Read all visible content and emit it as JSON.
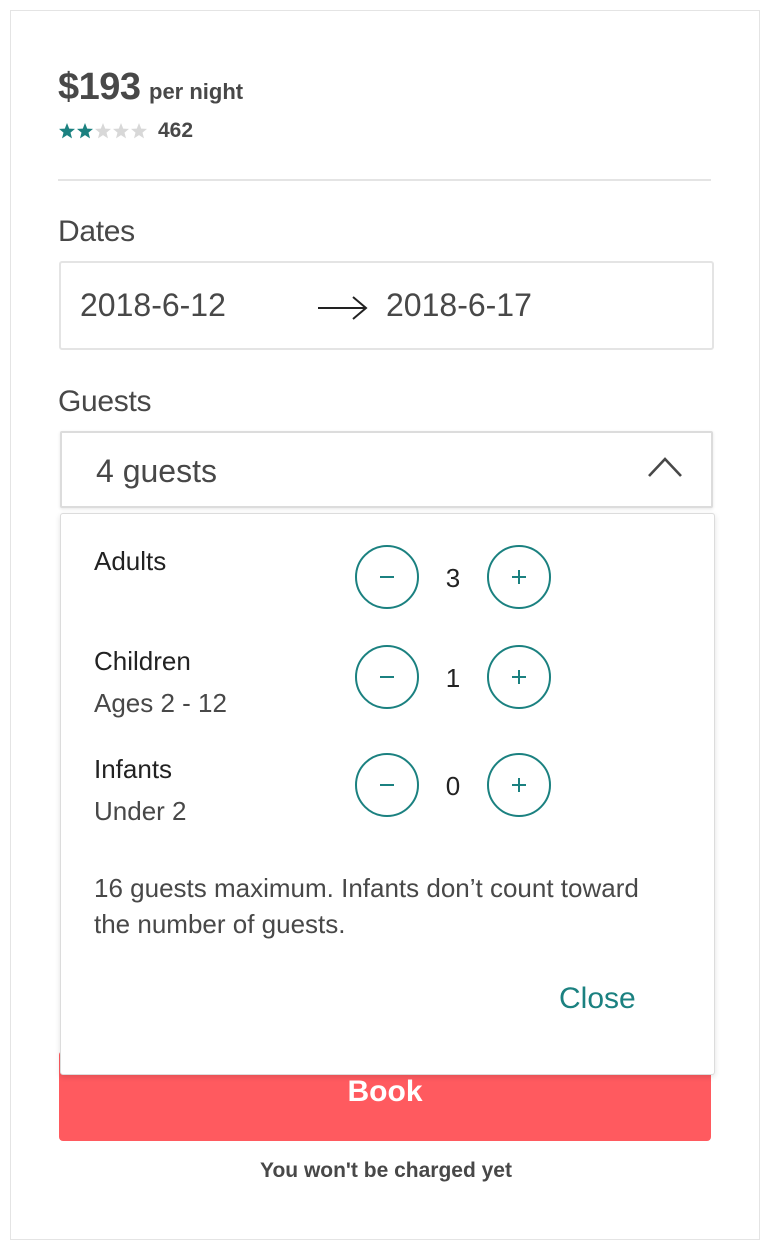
{
  "listing": {
    "price": "$193",
    "price_unit": "per night",
    "rating_stars": 2,
    "rating_max": 5,
    "review_count": "462"
  },
  "dates": {
    "label": "Dates",
    "start": "2018-6-12",
    "end": "2018-6-17"
  },
  "guests": {
    "label": "Guests",
    "summary": "4 guests",
    "rows": [
      {
        "title": "Adults",
        "subtitle": "",
        "count": "3"
      },
      {
        "title": "Children",
        "subtitle": "Ages 2 - 12",
        "count": "1"
      },
      {
        "title": "Infants",
        "subtitle": "Under 2",
        "count": "0"
      }
    ],
    "note": "16 guests maximum. Infants don’t count toward the number of guests.",
    "close_label": "Close"
  },
  "booking": {
    "button_label": "Book",
    "note": "You won't be charged yet"
  },
  "colors": {
    "accent": "#1b8180",
    "brand": "#ff5a5f",
    "star_empty": "#d8d8d8"
  },
  "icons": [
    "star-icon",
    "arrow-right-icon",
    "chevron-up-icon",
    "minus-icon",
    "plus-icon"
  ]
}
